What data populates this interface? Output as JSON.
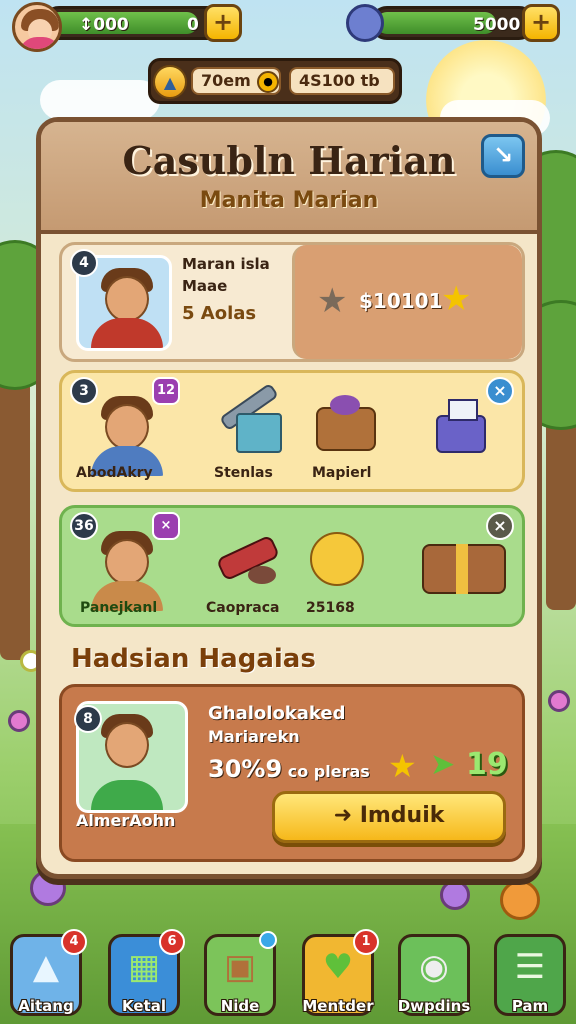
{
  "hud": {
    "left_value": "↕000",
    "left_value2": "0",
    "left_plus": "+",
    "right_value": "5000",
    "right_plus": "+"
  },
  "currency": {
    "seg1": "70em",
    "seg2": "4S100 tb"
  },
  "panel": {
    "title": "Casubln Harian",
    "subtitle": "Manita Marian",
    "head_button": "↘"
  },
  "card1": {
    "badge": "4",
    "name_line1": "Maran isla",
    "name_line2": "Maae",
    "count": "5 Aolas",
    "reward": "$10101"
  },
  "card2": {
    "badge": "3",
    "tag": "12",
    "close": "×",
    "items": [
      {
        "label": "AbodAkry"
      },
      {
        "label": "Stenlas"
      },
      {
        "label": "Mapierl"
      },
      {
        "label": ""
      }
    ]
  },
  "card3": {
    "badge": "36",
    "tag": "×",
    "close": "×",
    "items": [
      {
        "label": "Panejkanl"
      },
      {
        "label": "Caopraca"
      },
      {
        "label": "25168"
      },
      {
        "label": ""
      }
    ]
  },
  "section": {
    "title": "Hadsian Hagaias"
  },
  "card4": {
    "badge": "8",
    "portrait_label": "AlmerAohn",
    "line1": "Ghalolokaked",
    "line2": "Mariarekn",
    "stat": "30%9 co pleras",
    "stat_prefix": "30%9",
    "stat_suffix": "co pleras",
    "counter": "19",
    "cta": "Imduik"
  },
  "nav": [
    {
      "label": "Aitang",
      "badge": "4",
      "color": "#6fb3e8",
      "glyph": "▲"
    },
    {
      "label": "Ketal",
      "badge": "6",
      "color": "#3b8ed8",
      "glyph": "▦"
    },
    {
      "label": "Nide",
      "badge": "",
      "color": "#7cc45a",
      "glyph": "▣"
    },
    {
      "label": "Mentder",
      "badge": "1",
      "color": "#f1b731",
      "glyph": "♥"
    },
    {
      "label": "Dwpdins",
      "badge": "",
      "color": "#6cc05a",
      "glyph": "◉"
    },
    {
      "label": "Pam",
      "badge": "",
      "color": "#4fa64a",
      "glyph": "☰"
    }
  ]
}
